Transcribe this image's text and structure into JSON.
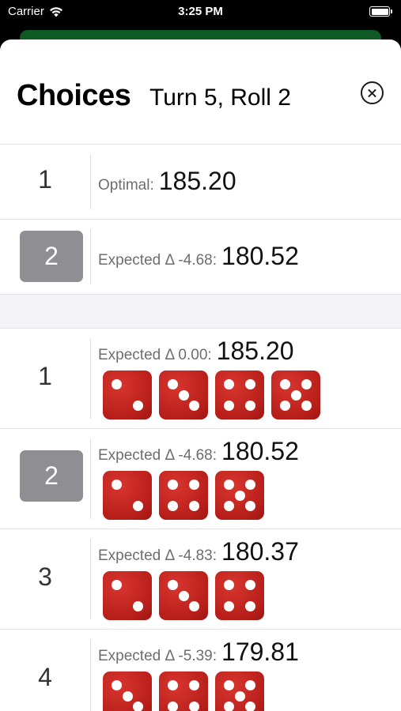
{
  "status_bar": {
    "carrier": "Carrier",
    "time": "3:25 PM"
  },
  "header": {
    "title": "Choices",
    "subtitle": "Turn 5, Roll 2"
  },
  "summary_rows": [
    {
      "number": "1",
      "label": "Optimal:",
      "value": "185.20",
      "selected": false
    },
    {
      "number": "2",
      "label": "Expected Δ -4.68:",
      "value": "180.52",
      "selected": true
    }
  ],
  "choice_rows": [
    {
      "number": "1",
      "label": "Expected Δ 0.00:",
      "value": "185.20",
      "selected": false,
      "dice": [
        2,
        3,
        4,
        5
      ]
    },
    {
      "number": "2",
      "label": "Expected Δ -4.68:",
      "value": "180.52",
      "selected": true,
      "dice": [
        2,
        4,
        5
      ]
    },
    {
      "number": "3",
      "label": "Expected Δ -4.83:",
      "value": "180.37",
      "selected": false,
      "dice": [
        2,
        3,
        4
      ]
    },
    {
      "number": "4",
      "label": "Expected Δ -5.39:",
      "value": "179.81",
      "selected": false,
      "dice": [
        3,
        4,
        5
      ]
    }
  ],
  "colors": {
    "die": "#b81f1a",
    "selected_badge": "#8e8e93",
    "underlay": "#0f5a24"
  }
}
